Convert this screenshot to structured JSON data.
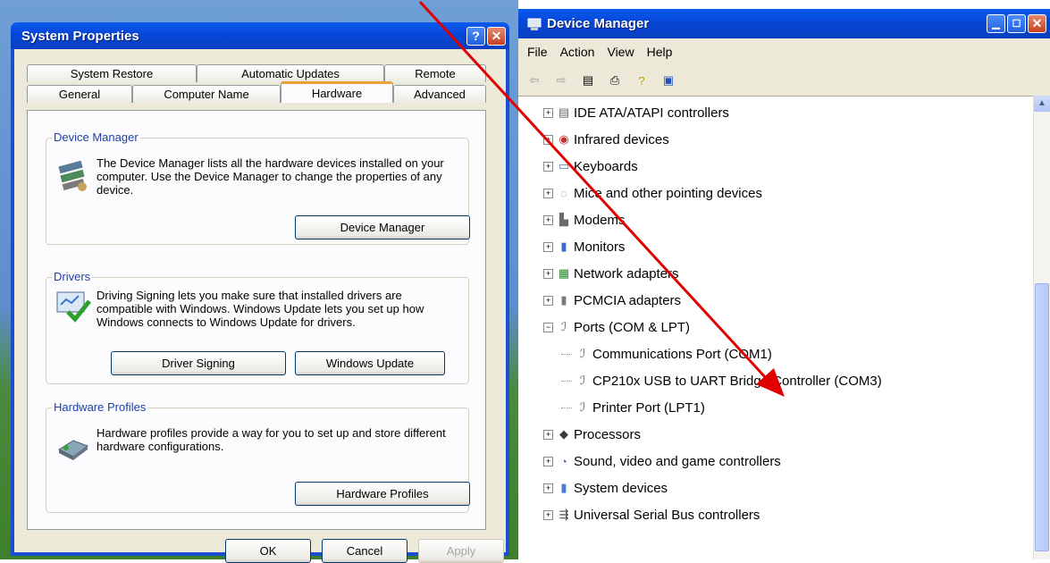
{
  "system_properties": {
    "title": "System Properties",
    "help_button": "?",
    "close_button": "✕",
    "tabs_back": [
      "System Restore",
      "Automatic Updates",
      "Remote"
    ],
    "tabs_front": [
      "General",
      "Computer Name",
      "Hardware",
      "Advanced"
    ],
    "device_manager": {
      "legend": "Device Manager",
      "text": "The Device Manager lists all the hardware devices installed on your computer. Use the Device Manager to change the properties of any device.",
      "button": "Device Manager"
    },
    "drivers": {
      "legend": "Drivers",
      "text": "Driving Signing lets you make sure that installed drivers are compatible with Windows. Windows Update lets you set up how Windows connects to Windows Update for drivers.",
      "button_signing": "Driver Signing",
      "button_update": "Windows Update"
    },
    "hardware_profiles": {
      "legend": "Hardware Profiles",
      "text": "Hardware profiles provide a way for you to set up and store different hardware configurations.",
      "button": "Hardware Profiles"
    },
    "ok": "OK",
    "cancel": "Cancel",
    "apply": "Apply"
  },
  "device_manager_window": {
    "title": "Device Manager",
    "menu": [
      "File",
      "Action",
      "View",
      "Help"
    ],
    "tree": [
      {
        "label": "IDE ATA/ATAPI controllers",
        "icon": "ide-controller-icon",
        "expander": "+"
      },
      {
        "label": "Infrared devices",
        "icon": "infrared-icon",
        "expander": "+"
      },
      {
        "label": "Keyboards",
        "icon": "keyboard-icon",
        "expander": "+"
      },
      {
        "label": "Mice and other pointing devices",
        "icon": "mouse-icon",
        "expander": "+"
      },
      {
        "label": "Modems",
        "icon": "modem-icon",
        "expander": "+"
      },
      {
        "label": "Monitors",
        "icon": "monitor-icon",
        "expander": "+"
      },
      {
        "label": "Network adapters",
        "icon": "network-adapter-icon",
        "expander": "+"
      },
      {
        "label": "PCMCIA adapters",
        "icon": "pcmcia-icon",
        "expander": "+"
      },
      {
        "label": "Ports (COM & LPT)",
        "icon": "port-icon",
        "expander": "−"
      },
      {
        "label": "Communications Port (COM1)",
        "icon": "port-icon",
        "child": true
      },
      {
        "label": "CP210x USB to UART Bridge Controller (COM3)",
        "icon": "port-icon",
        "child": true
      },
      {
        "label": "Printer Port (LPT1)",
        "icon": "port-icon",
        "child": true
      },
      {
        "label": "Processors",
        "icon": "processor-icon",
        "expander": "+"
      },
      {
        "label": "Sound, video and game controllers",
        "icon": "sound-icon",
        "expander": "+"
      },
      {
        "label": "System devices",
        "icon": "system-device-icon",
        "expander": "+"
      },
      {
        "label": "Universal Serial Bus controllers",
        "icon": "usb-icon",
        "expander": "+"
      }
    ]
  },
  "colors": {
    "arrow": "#e00000",
    "title_bar": "#0646d6",
    "dialog_face": "#ece9d8"
  }
}
